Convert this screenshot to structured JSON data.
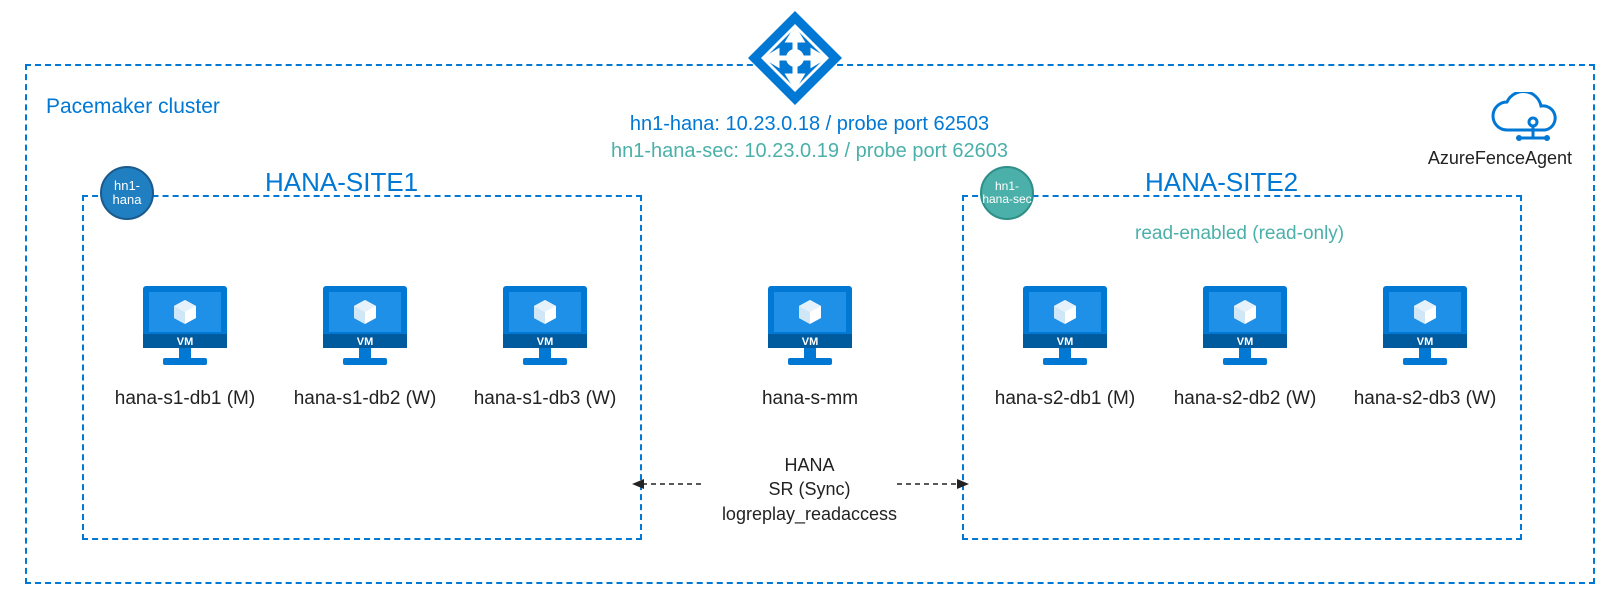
{
  "cluster_label": "Pacemaker cluster",
  "lb_line1": "hn1-hana:  10.23.0.18 / probe port 62503",
  "lb_line2": "hn1-hana-sec: 10.23.0.19 / probe port 62603",
  "fence_label": "AzureFenceAgent",
  "site1": {
    "title": "HANA-SITE1",
    "vip_label": "hn1-hana"
  },
  "site2": {
    "title": "HANA-SITE2",
    "vip_label": "hn1-hana-sec",
    "read_only": "read-enabled (read-only)"
  },
  "vms": {
    "s1db1": "hana-s1-db1 (M)",
    "s1db2": "hana-s1-db2 (W)",
    "s1db3": "hana-s1-db3 (W)",
    "mm": "hana-s-mm",
    "s2db1": "hana-s2-db1 (M)",
    "s2db2": "hana-s2-db2 (W)",
    "s2db3": "hana-s2-db3 (W)"
  },
  "vm_badge": "VM",
  "sr": {
    "l1": "HANA",
    "l2": "SR (Sync)",
    "l3": "logreplay_readaccess"
  }
}
